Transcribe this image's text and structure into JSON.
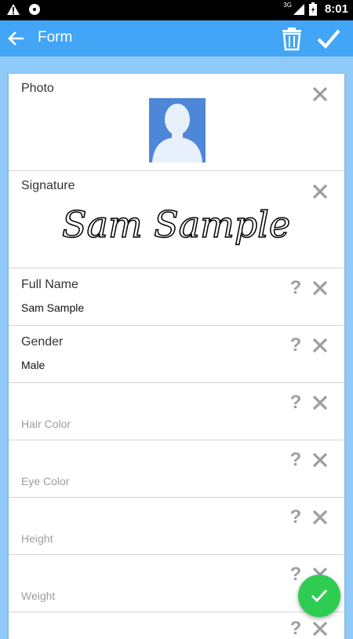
{
  "status_bar": {
    "time": "8:01",
    "network": "3G"
  },
  "app_bar": {
    "title": "Form"
  },
  "fields": [
    {
      "label": "Photo"
    },
    {
      "label": "Signature",
      "signature_text": "Sam Sample"
    },
    {
      "label": "Full Name",
      "value": "Sam Sample"
    },
    {
      "label": "Gender",
      "value": "Male"
    },
    {
      "label": "Hair Color",
      "value": ""
    },
    {
      "label": "Eye Color",
      "value": ""
    },
    {
      "label": "Height",
      "value": ""
    },
    {
      "label": "Weight",
      "value": ""
    }
  ],
  "colors": {
    "app_bar": "#42a5f5",
    "background": "#90caf9",
    "fab": "#2ecc50"
  },
  "icons": [
    "back-arrow-icon",
    "trash-icon",
    "check-icon",
    "close-icon",
    "help-icon",
    "check-fab-icon"
  ]
}
